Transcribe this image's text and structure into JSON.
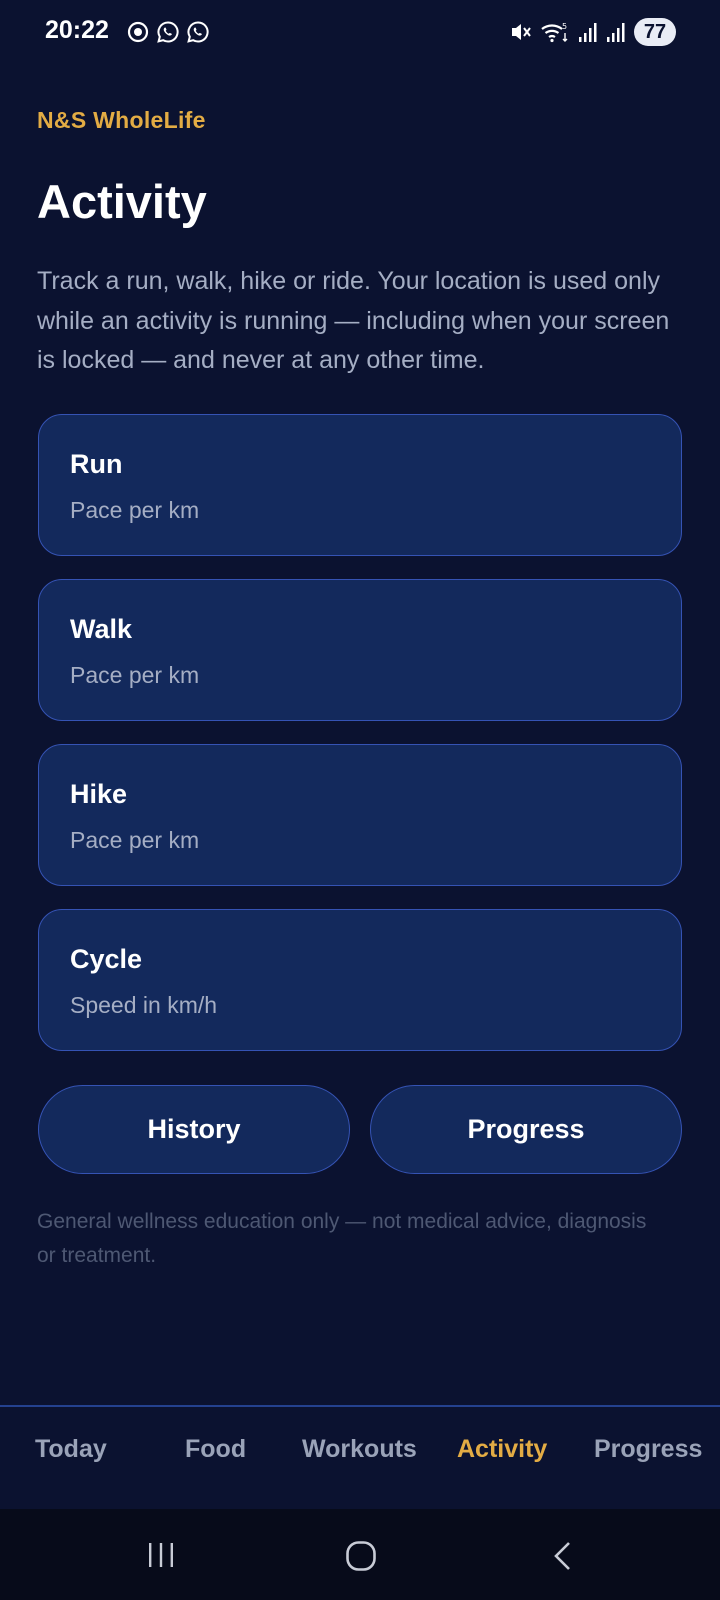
{
  "status_bar": {
    "time": "20:22",
    "battery": "77",
    "left_icons": [
      "screen-record-icon",
      "whatsapp-icon",
      "whatsapp-icon"
    ],
    "right_icons": [
      "mute-icon",
      "wifi-5g-icon",
      "signal-icon",
      "signal-icon"
    ]
  },
  "header": {
    "brand": "N&S WholeLife",
    "title": "Activity",
    "intro": "Track a run, walk, hike or ride. Your location is used only while an activity is running — including when your screen is locked — and never at any other time."
  },
  "activities": [
    {
      "title": "Run",
      "subtitle": "Pace per km"
    },
    {
      "title": "Walk",
      "subtitle": "Pace per km"
    },
    {
      "title": "Hike",
      "subtitle": "Pace per km"
    },
    {
      "title": "Cycle",
      "subtitle": "Speed in km/h"
    }
  ],
  "buttons": {
    "history": "History",
    "progress": "Progress"
  },
  "disclaimer": "General wellness education only — not medical advice, diagnosis or treatment.",
  "tabs": [
    {
      "label": "Today",
      "active": false
    },
    {
      "label": "Food",
      "active": false
    },
    {
      "label": "Workouts",
      "active": false
    },
    {
      "label": "Activity",
      "active": true
    },
    {
      "label": "Progress",
      "active": false
    }
  ],
  "system_nav": [
    "recents-icon",
    "home-icon",
    "back-icon"
  ],
  "colors": {
    "background": "#0b1230",
    "card": "#13295c",
    "card_border": "#3553b4",
    "accent": "#e3ac44",
    "muted_text": "#a5aec4"
  }
}
